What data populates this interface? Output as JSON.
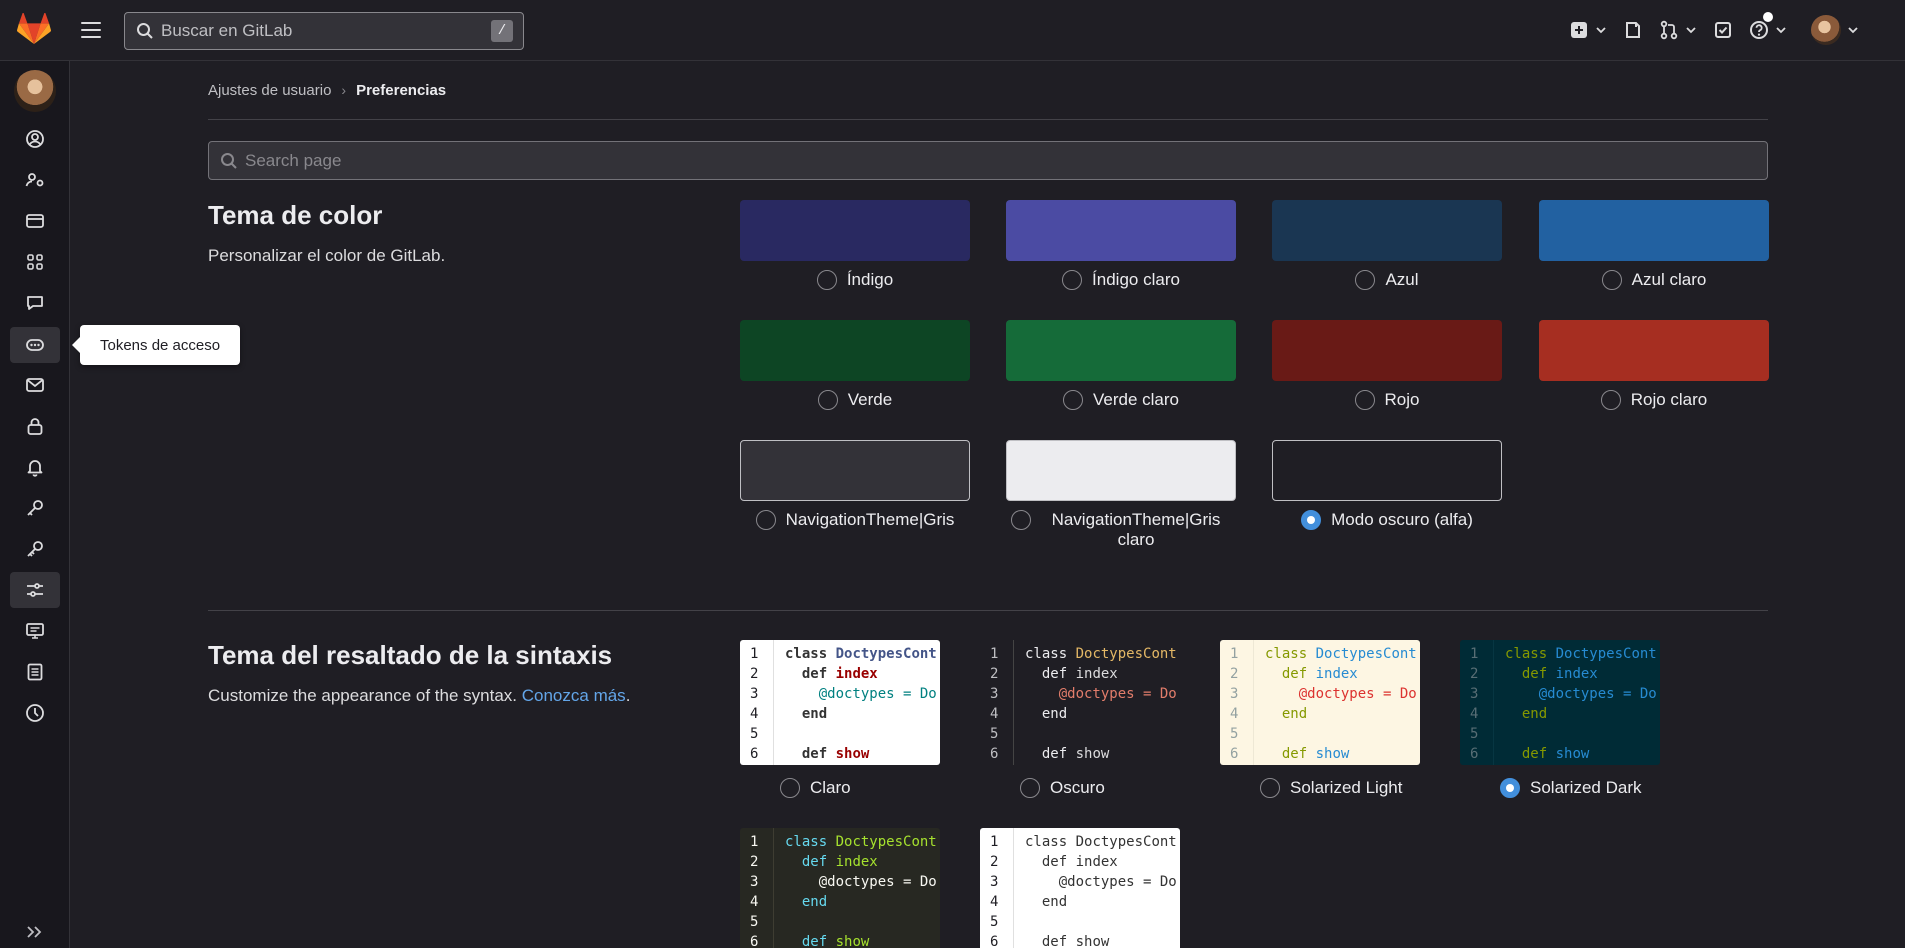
{
  "topbar": {
    "search_placeholder": "Buscar en GitLab",
    "search_shortcut": "/"
  },
  "tooltip": {
    "label": "Tokens de acceso"
  },
  "breadcrumb": {
    "parent": "Ajustes de usuario",
    "current": "Preferencias"
  },
  "page_search": {
    "placeholder": "Search page"
  },
  "color_theme": {
    "title": "Tema de color",
    "description": "Personalizar el color de GitLab.",
    "options": [
      {
        "label": "Índigo",
        "color": "#292961",
        "checked": false
      },
      {
        "label": "Índigo claro",
        "color": "#4b4ba3",
        "checked": false
      },
      {
        "label": "Azul",
        "color": "#1a3652",
        "checked": false
      },
      {
        "label": "Azul claro",
        "color": "#2261a1",
        "checked": false
      },
      {
        "label": "Verde",
        "color": "#0d4524",
        "checked": false
      },
      {
        "label": "Verde claro",
        "color": "#156b39",
        "checked": false
      },
      {
        "label": "Rojo",
        "color": "#691a16",
        "checked": false
      },
      {
        "label": "Rojo claro",
        "color": "#a62e21",
        "checked": false
      },
      {
        "label": "NavigationTheme|Gris",
        "color": "#333238",
        "checked": false
      },
      {
        "label": "NavigationTheme|Gris claro",
        "color": "#ececef",
        "checked": false
      },
      {
        "label": "Modo oscuro (alfa)",
        "color": "#1f1e24",
        "checked": true
      }
    ]
  },
  "syntax_theme": {
    "title": "Tema del resaltado de la sintaxis",
    "description": "Customize the appearance of the syntax.",
    "learn_more": "Conozca más",
    "period": ".",
    "options": [
      {
        "label": "Claro",
        "checked": false
      },
      {
        "label": "Oscuro",
        "checked": false
      },
      {
        "label": "Solarized Light",
        "checked": false
      },
      {
        "label": "Solarized Dark",
        "checked": true
      }
    ],
    "code_lines": [
      "class DoctypesCont",
      "  def index",
      "    @doctypes = Do",
      "  end",
      "",
      "  def show"
    ],
    "line_numbers": [
      "1",
      "2",
      "3",
      "4",
      "5",
      "6"
    ]
  }
}
